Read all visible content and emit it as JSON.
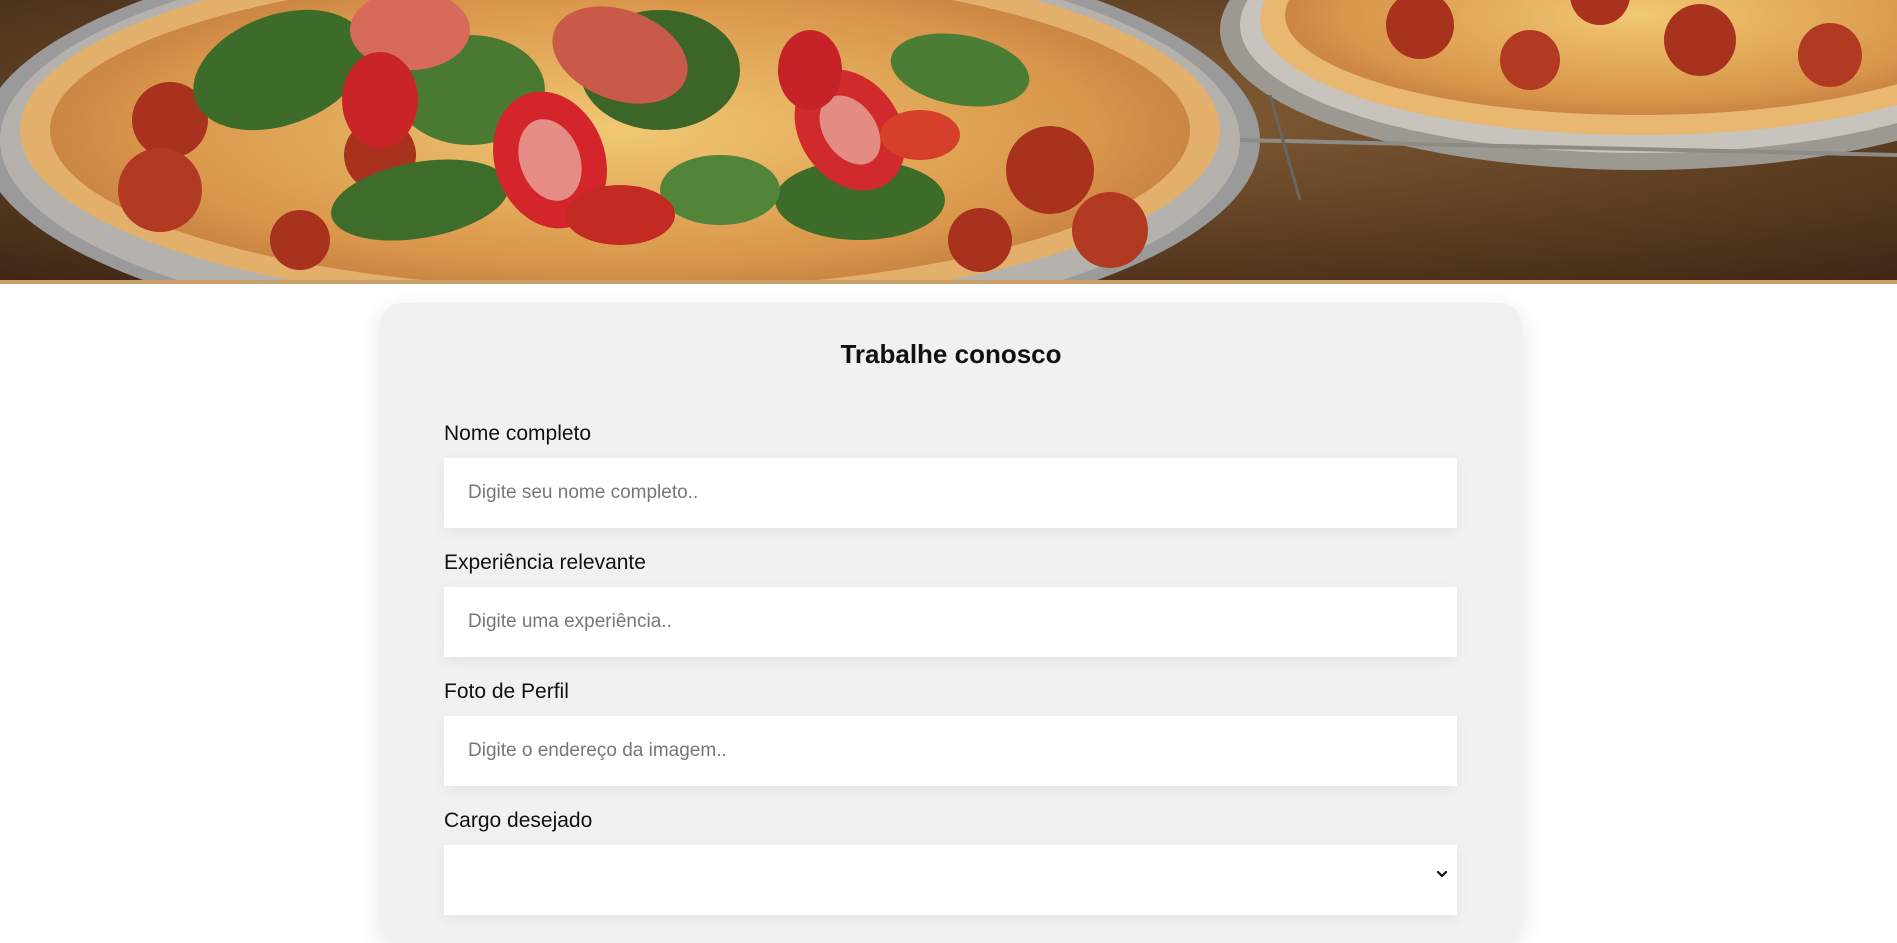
{
  "hero": {
    "image_alt": "Pizzas com morangos, espinafre e presunto"
  },
  "form": {
    "title": "Trabalhe conosco",
    "fields": [
      {
        "label": "Nome completo",
        "placeholder": "Digite seu nome completo..",
        "value": ""
      },
      {
        "label": "Experiência relevante",
        "placeholder": "Digite uma experiência..",
        "value": ""
      },
      {
        "label": "Foto de Perfil",
        "placeholder": "Digite o endereço da imagem..",
        "value": ""
      }
    ],
    "cargo": {
      "label": "Cargo desejado",
      "selected": ""
    }
  },
  "icons": {
    "select_arrow": "chevron-down-icon"
  },
  "colors": {
    "card_bg": "#f1f1f1",
    "hero_border": "#c9a06a",
    "page_bg": "#ffffff"
  }
}
